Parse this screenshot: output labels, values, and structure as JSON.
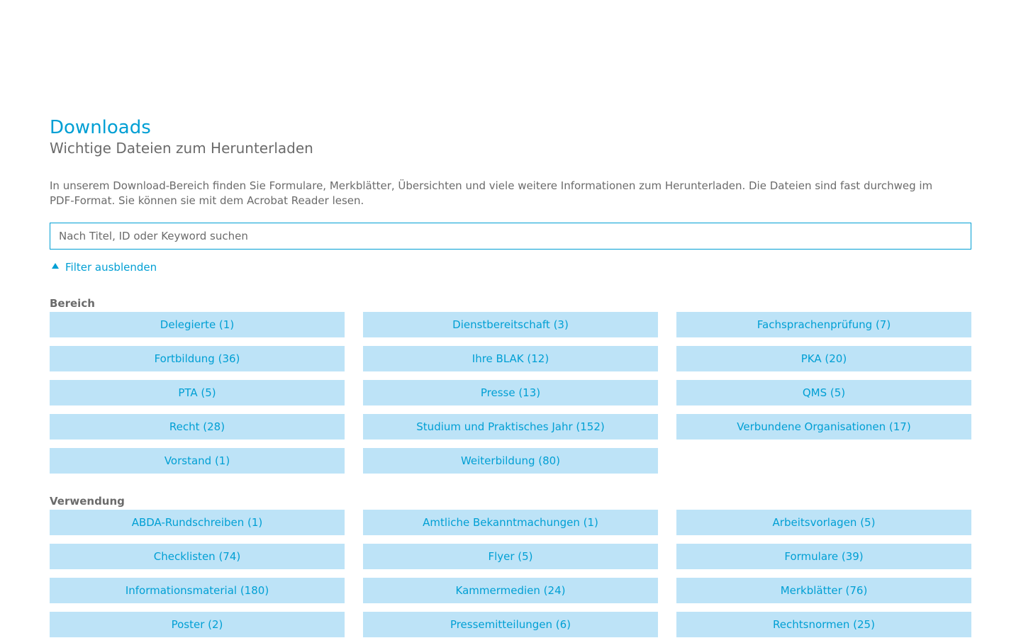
{
  "header": {
    "title": "Downloads",
    "subtitle": "Wichtige Dateien zum Herunterladen"
  },
  "intro": "In unserem Download-Bereich finden Sie Formulare, Merkblätter, Übersichten und viele weitere Informationen zum Herunterladen. Die Dateien sind fast durchweg im PDF-Format. Sie können sie mit dem Acrobat Reader lesen.",
  "search": {
    "placeholder": "Nach Titel, ID oder Keyword suchen",
    "value": ""
  },
  "filter_toggle": {
    "label": "Filter ausblenden",
    "icon": "caret-up-icon"
  },
  "groups": {
    "bereich": {
      "label": "Bereich",
      "items": [
        "Delegierte (1)",
        "Dienstbereitschaft (3)",
        "Fachsprachenprüfung (7)",
        "Fortbildung (36)",
        "Ihre BLAK (12)",
        "PKA (20)",
        "PTA (5)",
        "Presse (13)",
        "QMS (5)",
        "Recht (28)",
        "Studium und Praktisches Jahr (152)",
        "Verbundene Organisationen (17)",
        "Vorstand (1)",
        "Weiterbildung (80)"
      ]
    },
    "verwendung": {
      "label": "Verwendung",
      "items": [
        "ABDA-Rundschreiben (1)",
        "Amtliche Bekanntmachungen (1)",
        "Arbeitsvorlagen (5)",
        "Checklisten (74)",
        "Flyer (5)",
        "Formulare (39)",
        "Informationsmaterial (180)",
        "Kammermedien (24)",
        "Merkblätter (76)",
        "Poster (2)",
        "Pressemitteilungen (6)",
        "Rechtsnormen (25)"
      ]
    }
  },
  "colors": {
    "accent": "#009fd4",
    "chip_background": "#bde3f7",
    "text_muted": "#6b6b6b"
  }
}
